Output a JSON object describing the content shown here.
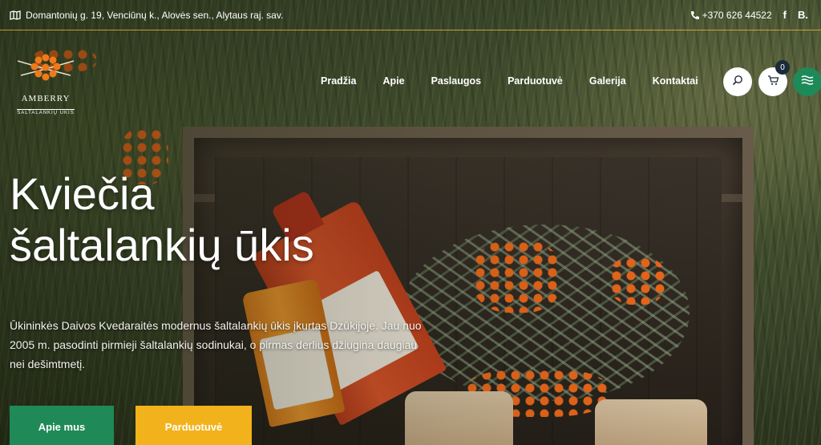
{
  "topbar": {
    "address": "Domantonių g. 19, Venciūnų k., Alovės sen., Alytaus raj. sav.",
    "phone": "+370 626 44522",
    "social_fb": "f",
    "social_booking": "B."
  },
  "logo": {
    "name": "AMBERRY",
    "subtitle": "ŠALTALANKIŲ ŪKIS"
  },
  "nav": {
    "items": [
      {
        "label": "Pradžia"
      },
      {
        "label": "Apie"
      },
      {
        "label": "Paslaugos"
      },
      {
        "label": "Parduotuvė"
      },
      {
        "label": "Galerija"
      },
      {
        "label": "Kontaktai"
      }
    ]
  },
  "header_actions": {
    "cart_count": "0",
    "icons": [
      "search-icon",
      "cart-icon",
      "menu-icon"
    ]
  },
  "hero": {
    "title_line1": "Kviečia",
    "title_line2": "šaltalankių ūkis",
    "text": "Ūkininkės Daivos Kvedaraitės modernus šaltalankių ūkis įkurtas Dzūkijoje. Jau nuo 2005 m. pasodinti pirmieji šaltalankių sodinukai, o pirmas derlius džiugina daugiau nei dešimtmetį.",
    "cta_about": "Apie mus",
    "cta_shop": "Parduotuvė"
  },
  "colors": {
    "accent_green": "#1f8a57",
    "accent_yellow": "#f2b21b",
    "topbar_line": "#f0be3c",
    "cart_badge": "#1c2b3a"
  }
}
